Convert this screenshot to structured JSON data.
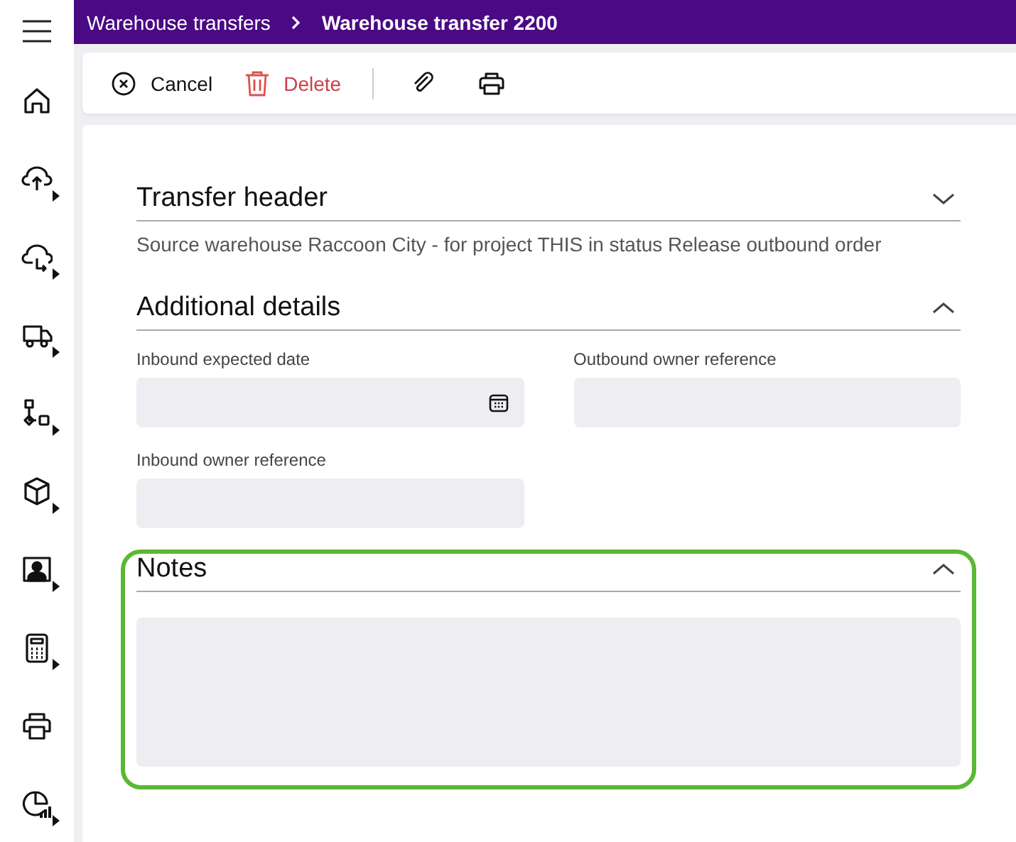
{
  "breadcrumb": [
    {
      "label": "Warehouse transfers",
      "current": false
    },
    {
      "label": "Warehouse transfer 2200",
      "current": true
    }
  ],
  "toolbar": [
    {
      "kind": "cancel",
      "label": "Cancel"
    },
    {
      "kind": "delete",
      "label": "Delete"
    },
    {
      "kind": "separator"
    },
    {
      "kind": "attach"
    },
    {
      "kind": "print"
    }
  ],
  "nav": [
    {
      "kind": "home",
      "has_submenu": false
    },
    {
      "kind": "upload",
      "has_submenu": true
    },
    {
      "kind": "cloud-out",
      "has_submenu": true
    },
    {
      "kind": "truck",
      "has_submenu": true
    },
    {
      "kind": "flow",
      "has_submenu": true
    },
    {
      "kind": "box",
      "has_submenu": true
    },
    {
      "kind": "person",
      "has_submenu": true
    },
    {
      "kind": "calculator",
      "has_submenu": true
    },
    {
      "kind": "printer",
      "has_submenu": false
    },
    {
      "kind": "chart",
      "has_submenu": true
    }
  ],
  "sections": [
    {
      "kind": "summary",
      "title": "Transfer header",
      "expanded": false,
      "highlighted": false,
      "summary": "Source warehouse Raccoon City - for project THIS in status Release outbound order"
    },
    {
      "kind": "fields",
      "title": "Additional details",
      "expanded": true,
      "highlighted": false,
      "fields": [
        {
          "label": "Inbound expected date",
          "kind": "date"
        },
        {
          "label": "Outbound owner reference",
          "kind": "text"
        },
        {
          "label": "Inbound owner reference",
          "kind": "text"
        }
      ]
    },
    {
      "kind": "notes",
      "title": "Notes",
      "expanded": true,
      "highlighted": true
    }
  ]
}
